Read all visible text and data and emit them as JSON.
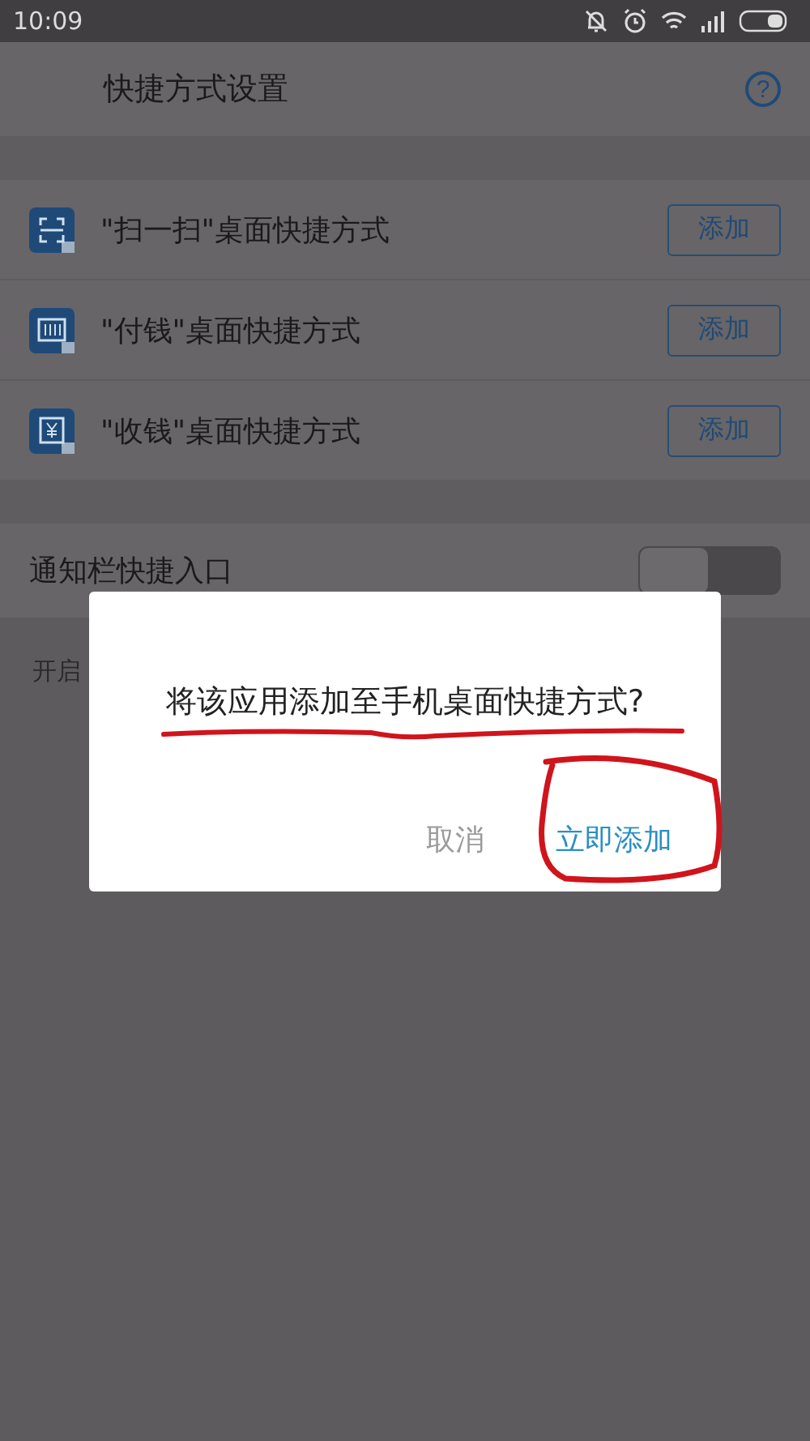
{
  "status_bar": {
    "time": "10:09"
  },
  "header": {
    "title": "快捷方式设置",
    "help": "?"
  },
  "shortcuts": [
    {
      "kind": "scan",
      "label": "\"扫一扫\"桌面快捷方式",
      "button": "添加"
    },
    {
      "kind": "pay",
      "label": "\"付钱\"桌面快捷方式",
      "button": "添加"
    },
    {
      "kind": "receive",
      "label": "\"收钱\"桌面快捷方式",
      "button": "添加"
    }
  ],
  "notification": {
    "label": "通知栏快捷入口",
    "on": false,
    "hint": "开启"
  },
  "dialog": {
    "message": "将该应用添加至手机桌面快捷方式?",
    "underlined": true,
    "buttons": [
      {
        "label": "取消",
        "kind": "cancel",
        "circled": false
      },
      {
        "label": "立即添加",
        "kind": "confirm",
        "circled": true
      }
    ]
  }
}
